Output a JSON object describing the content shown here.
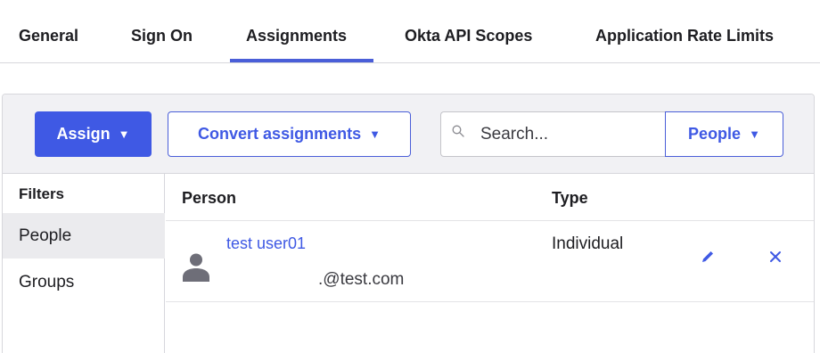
{
  "tabs": [
    {
      "label": "General"
    },
    {
      "label": "Sign On"
    },
    {
      "label": "Assignments"
    },
    {
      "label": "Okta API Scopes"
    },
    {
      "label": "Application Rate Limits"
    }
  ],
  "active_tab": "Assignments",
  "toolbar": {
    "assign_label": "Assign",
    "convert_label": "Convert assignments",
    "search": {
      "placeholder": "Search...",
      "value": ""
    },
    "search_scope_label": "People",
    "caret": "▼"
  },
  "filters": {
    "title": "Filters",
    "items": [
      {
        "label": "People",
        "selected": true
      },
      {
        "label": "Groups",
        "selected": false
      }
    ]
  },
  "table": {
    "headers": {
      "person": "Person",
      "type": "Type"
    },
    "rows": [
      {
        "name": "test user01",
        "email_visible": ".@test.com",
        "type": "Individual"
      }
    ]
  },
  "icons": {
    "search": "search-icon",
    "avatar": "user-icon",
    "edit": "pencil-icon",
    "remove": "close-icon"
  },
  "colors": {
    "accent": "#3f59e4",
    "toolbar_bg": "#f1f1f4",
    "selected_filter_bg": "#ebebee",
    "border": "#d7d7dc"
  }
}
